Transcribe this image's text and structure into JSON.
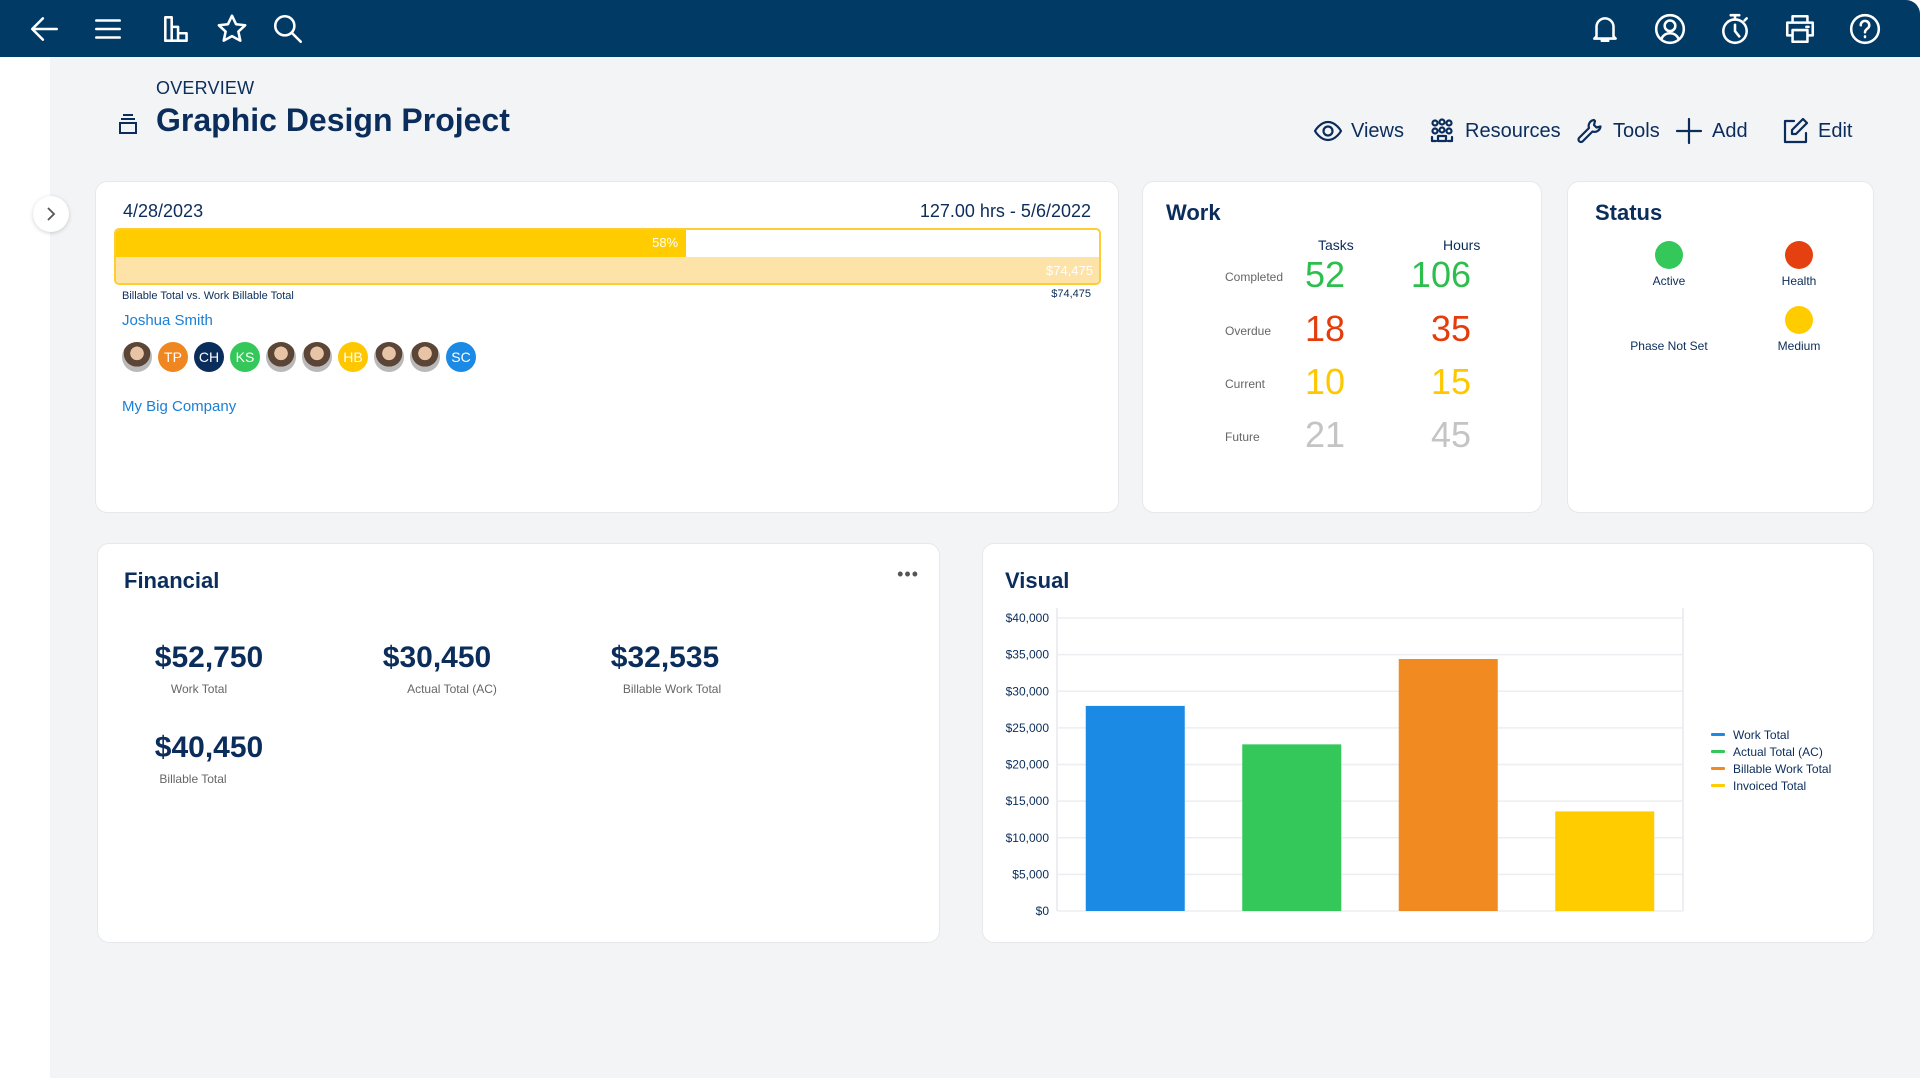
{
  "topbar": {
    "left_icons": [
      "back-arrow-icon",
      "menu-icon",
      "reports-icon",
      "favorites-star-icon",
      "search-icon"
    ],
    "right_icons": [
      "notifications-bell-icon",
      "user-profile-icon",
      "timer-icon",
      "print-icon",
      "help-icon"
    ]
  },
  "header": {
    "overline": "OVERVIEW",
    "title": "Graphic Design Project",
    "title_icon": "project-stack-icon"
  },
  "toolbar": {
    "views": "Views",
    "resources": "Resources",
    "tools": "Tools",
    "add": "Add",
    "edit": "Edit"
  },
  "summary": {
    "start_date": "4/28/2023",
    "hours_and_date": "127.00 hrs - 5/6/2022",
    "progress_percent": 58,
    "progress_label": "58%",
    "billable_amount_in_bar": "$74,475",
    "caption": "Billable Total vs. Work Billable Total",
    "billable_amount_below": "$74,475",
    "owner": "Joshua Smith",
    "company": "My Big Company",
    "team": [
      {
        "type": "photo",
        "initials": ""
      },
      {
        "type": "initials",
        "initials": "TP",
        "color": "#f0861f"
      },
      {
        "type": "initials",
        "initials": "CH",
        "color": "#0b2d5b"
      },
      {
        "type": "initials",
        "initials": "KS",
        "color": "#34c759"
      },
      {
        "type": "photo",
        "initials": ""
      },
      {
        "type": "photo",
        "initials": ""
      },
      {
        "type": "initials",
        "initials": "HB",
        "color": "#ffc700"
      },
      {
        "type": "photo",
        "initials": ""
      },
      {
        "type": "photo",
        "initials": ""
      },
      {
        "type": "initials",
        "initials": "SC",
        "color": "#1b8ae4"
      }
    ]
  },
  "work": {
    "title": "Work",
    "col_tasks": "Tasks",
    "col_hours": "Hours",
    "rows": [
      {
        "label": "Completed",
        "tasks": "52",
        "hours": "106",
        "color": "#2dbe4e"
      },
      {
        "label": "Overdue",
        "tasks": "18",
        "hours": "35",
        "color": "#e53c0c"
      },
      {
        "label": "Current",
        "tasks": "10",
        "hours": "15",
        "color": "#ffc700"
      },
      {
        "label": "Future",
        "tasks": "21",
        "hours": "45",
        "color": "#c4c4c4"
      }
    ]
  },
  "status": {
    "title": "Status",
    "items": [
      {
        "label": "Active",
        "color": "#34c759"
      },
      {
        "label": "Health",
        "color": "#e5400f"
      },
      {
        "label": "Phase Not Set",
        "color": null
      },
      {
        "label": "Medium",
        "color": "#ffcc00"
      }
    ]
  },
  "financial": {
    "title": "Financial",
    "more": "•••",
    "metrics": [
      {
        "value": "$52,750",
        "label": "Work Total"
      },
      {
        "value": "$30,450",
        "label": "Actual Total (AC)"
      },
      {
        "value": "$32,535",
        "label": "Billable Work Total"
      },
      {
        "value": "$40,450",
        "label": "Billable Total"
      }
    ]
  },
  "visual": {
    "title": "Visual"
  },
  "chart_data": {
    "type": "bar",
    "title": "Visual",
    "xlabel": "",
    "ylabel": "",
    "categories": [
      "Work Total",
      "Actual Total (AC)",
      "Billable Work Total",
      "Invoiced Total"
    ],
    "values": [
      28000,
      22750,
      34400,
      13600
    ],
    "colors": [
      "#1b8ae4",
      "#34c759",
      "#f08a21",
      "#ffcc00"
    ],
    "ylim": [
      0,
      40000
    ],
    "yticks": [
      0,
      5000,
      10000,
      15000,
      20000,
      25000,
      30000,
      35000,
      40000
    ],
    "ytick_labels": [
      "$0",
      "$5,000",
      "$10,000",
      "$15,000",
      "$20,000",
      "$25,000",
      "$30,000",
      "$35,000",
      "$40,000"
    ],
    "grid": true,
    "legend": [
      "Work Total",
      "Actual Total (AC)",
      "Billable Work Total",
      "Invoiced Total"
    ],
    "legend_position": "right"
  }
}
